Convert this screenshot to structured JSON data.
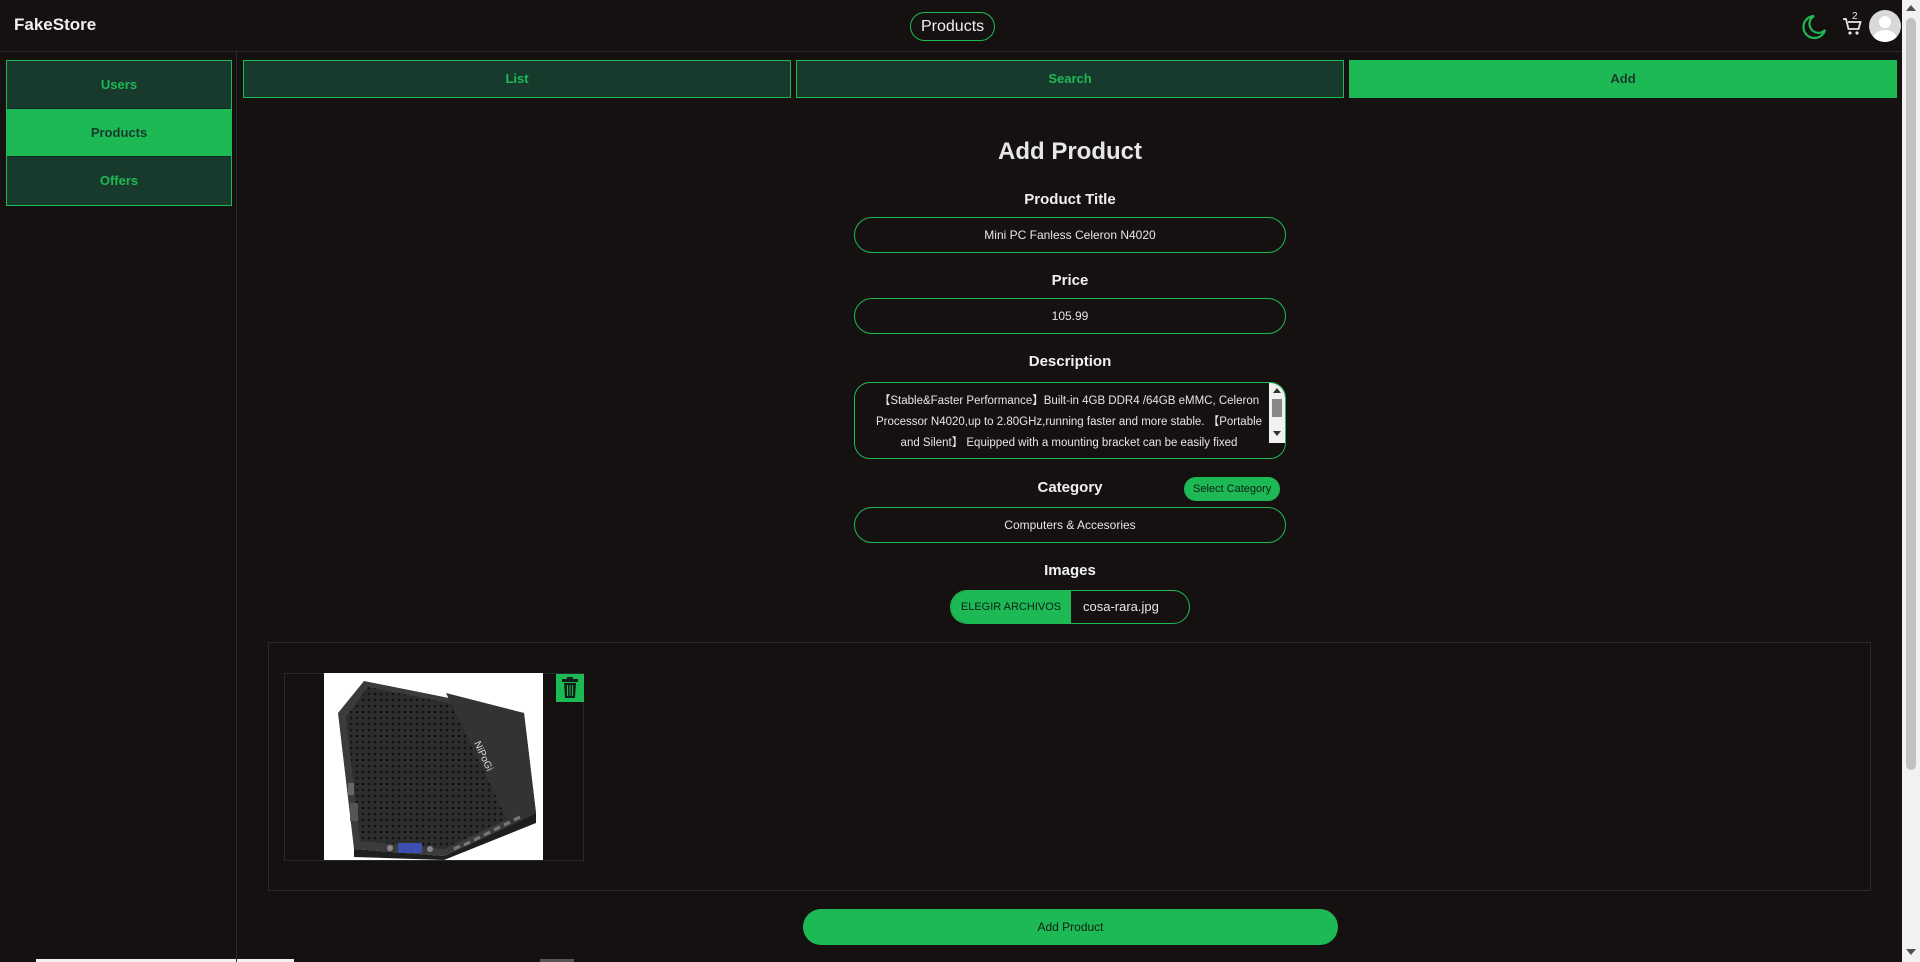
{
  "header": {
    "brand": "FakeStore",
    "page_label": "Products",
    "cart_count": "2"
  },
  "sidebar": {
    "items": [
      {
        "label": "Users",
        "active": false
      },
      {
        "label": "Products",
        "active": true
      },
      {
        "label": "Offers",
        "active": false
      }
    ]
  },
  "tabs": [
    {
      "label": "List",
      "active": false
    },
    {
      "label": "Search",
      "active": false
    },
    {
      "label": "Add",
      "active": true
    }
  ],
  "form": {
    "title": "Add Product",
    "product_title_label": "Product Title",
    "product_title_value": "Mini PC Fanless Celeron N4020",
    "price_label": "Price",
    "price_value": "105.99",
    "description_label": "Description",
    "description_value": "【Stable&Faster Performance】Built-in 4GB DDR4 /64GB eMMC, Celeron Processor N4020,up to 2.80GHz,running faster and more stable. 【Portable and Silent】 Equipped with a mounting bracket can be easily fixed",
    "category_label": "Category",
    "select_category_button": "Select Category",
    "category_value": "Computers & Accesories",
    "images_label": "Images",
    "file_button": "ELEGIR ARCHIVOS",
    "file_name": "cosa-rara.jpg",
    "image_brand_text": "NiPoGi",
    "submit_label": "Add Product"
  },
  "colors": {
    "accent": "#1db954",
    "background": "#151111",
    "panel": "#173a2d"
  }
}
